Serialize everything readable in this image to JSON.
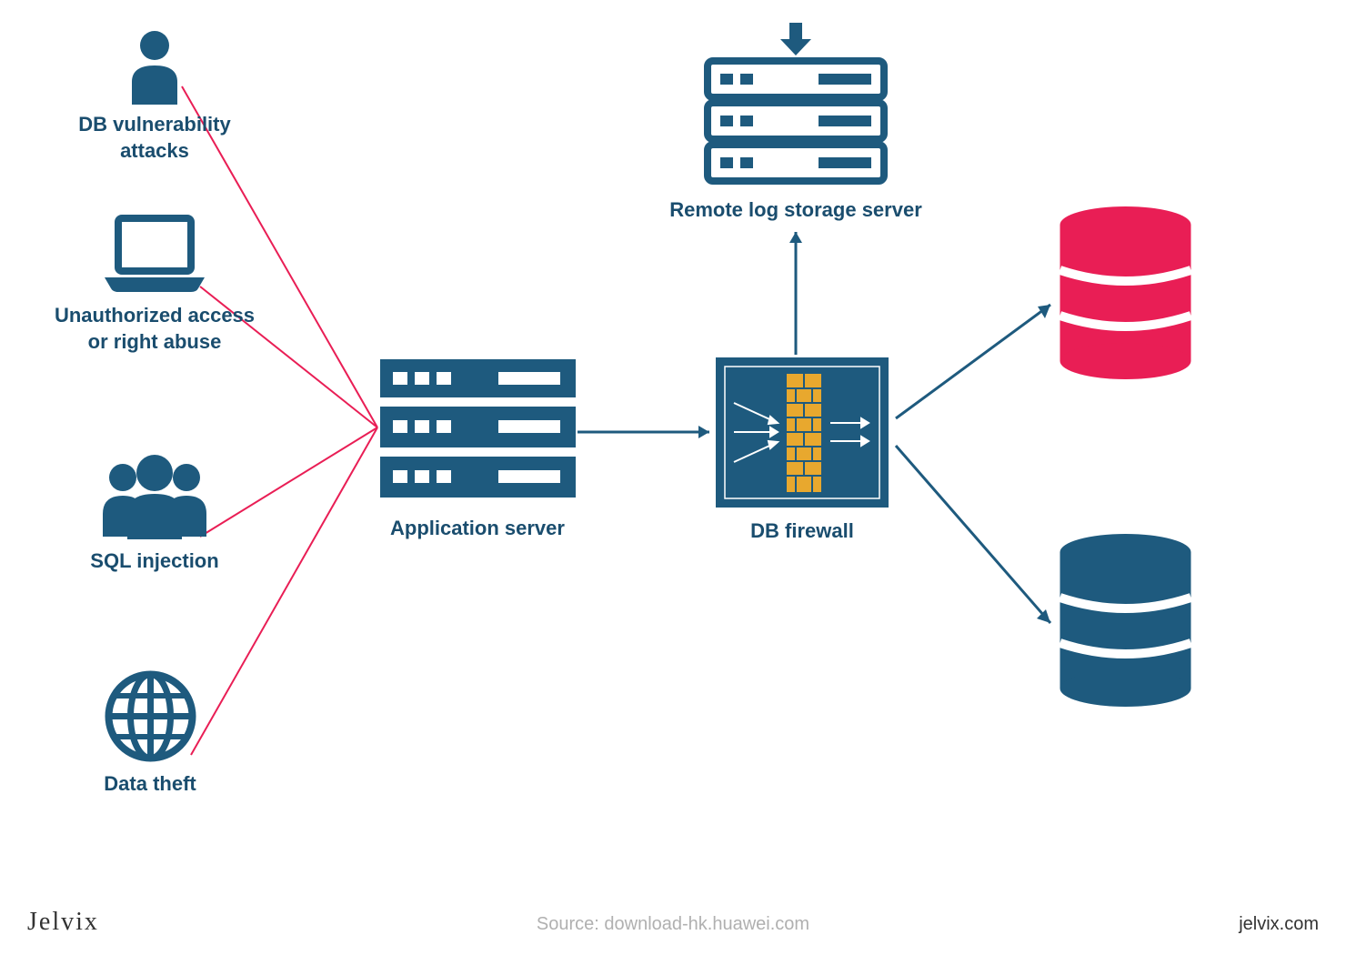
{
  "threats": {
    "db_vulnerability": "DB vulnerability\nattacks",
    "unauthorized_access": "Unauthorized access\nor right abuse",
    "sql_injection": "SQL injection",
    "data_theft": "Data theft"
  },
  "nodes": {
    "application_server": "Application server",
    "db_firewall": "DB firewall",
    "remote_log_storage": "Remote log storage server"
  },
  "footer": {
    "brand": "Jelvix",
    "source": "Source: download-hk.huawei.com",
    "site": "jelvix.com"
  },
  "colors": {
    "primary": "#1e5a7e",
    "accent": "#e91e55",
    "threat_line": "#e91e55",
    "arrow": "#1e5a7e",
    "firewall_bricks": "#e8a82e"
  }
}
